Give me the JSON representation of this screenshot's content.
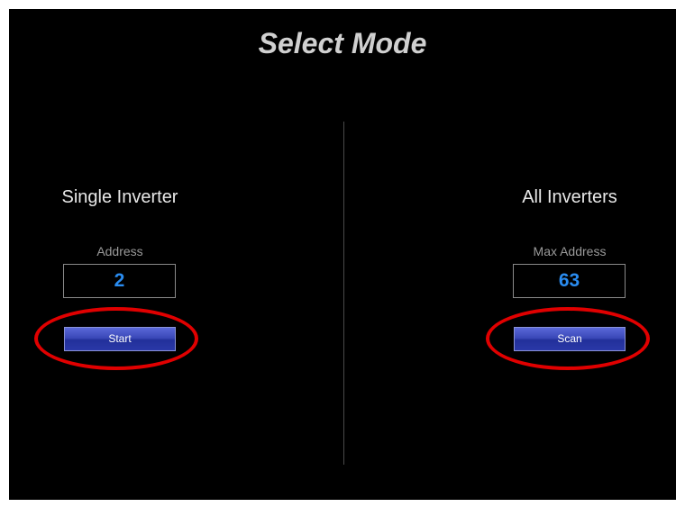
{
  "title": "Select Mode",
  "single": {
    "heading": "Single Inverter",
    "field_label": "Address",
    "field_value": "2",
    "button_label": "Start"
  },
  "all": {
    "heading": "All Inverters",
    "field_label": "Max Address",
    "field_value": "63",
    "button_label": "Scan"
  },
  "colors": {
    "background": "#000000",
    "value_text": "#2a8cf0",
    "button": "#3a48b8",
    "highlight_ring": "#e00000"
  }
}
